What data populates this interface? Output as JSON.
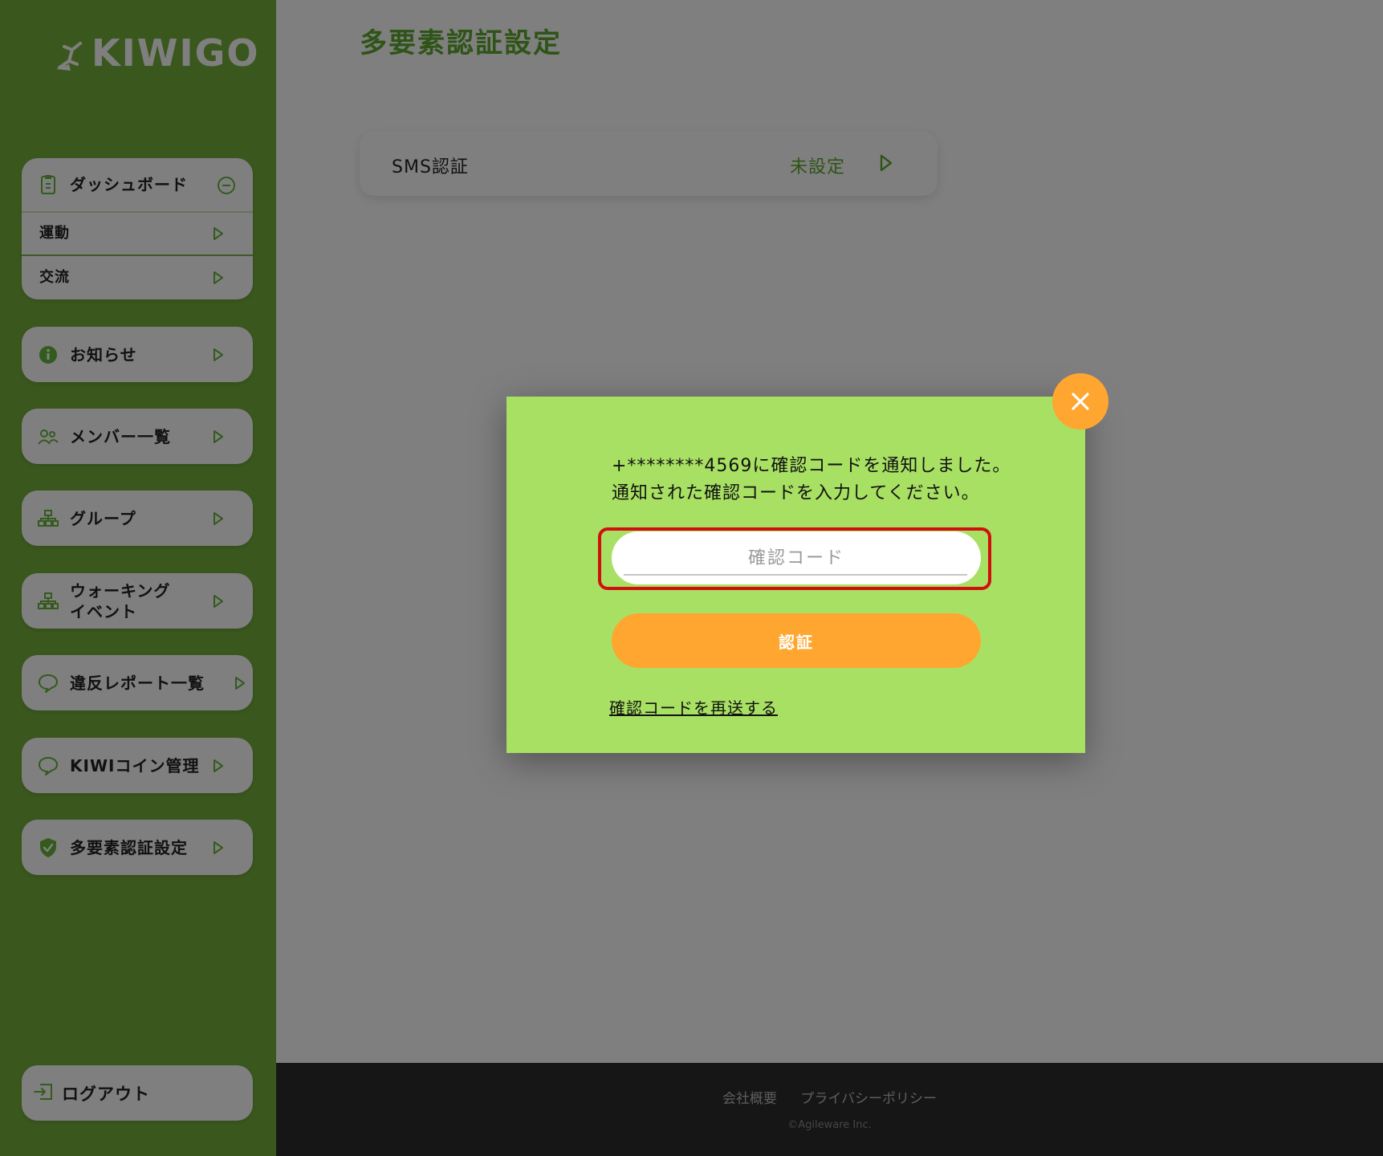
{
  "app": {
    "logo_text": "KIWIGO",
    "page_title": "多要素認証設定"
  },
  "colors": {
    "sidebar_green": "#75b03c",
    "accent_green": "#5fa82f",
    "modal_bg": "#a8e063",
    "orange": "#ffa630",
    "highlight_red": "#d20f0f",
    "footer_bg": "#2c2c2c"
  },
  "sidebar": {
    "dashboard": {
      "label": "ダッシュボード",
      "icon": "clipboard-icon",
      "toggle_icon": "minus-circle-icon",
      "sub_items": [
        {
          "label": "運動"
        },
        {
          "label": "交流"
        }
      ]
    },
    "items": [
      {
        "label": "お知らせ",
        "icon": "info-icon"
      },
      {
        "label": "メンバー一覧",
        "icon": "users-icon"
      },
      {
        "label": "グループ",
        "icon": "group-icon"
      },
      {
        "label": "ウォーキング\nイベント",
        "label_line1": "ウォーキング",
        "label_line2": "イベント",
        "icon": "group-icon"
      },
      {
        "label": "違反レポート一覧",
        "icon": "speech-bubble-icon"
      },
      {
        "label": "KIWIコイン管理",
        "icon": "speech-bubble-icon"
      },
      {
        "label": "多要素認証設定",
        "icon": "shield-icon"
      }
    ],
    "logout": {
      "label": "ログアウト",
      "icon": "logout-icon"
    }
  },
  "main": {
    "sms_card": {
      "label": "SMS認証",
      "status": "未設定",
      "arrow_icon": "play-arrow-icon"
    }
  },
  "modal": {
    "close_icon": "close-icon",
    "message_line1": "+********4569に確認コードを通知しました。",
    "message_line2": "通知された確認コードを入力してください。",
    "code_placeholder": "確認コード",
    "code_value": "",
    "verify_label": "認証",
    "resend_label": "確認コードを再送する"
  },
  "footer": {
    "link_company": "会社概要",
    "link_privacy": "プライバシーポリシー",
    "copyright": "©Agileware Inc."
  }
}
